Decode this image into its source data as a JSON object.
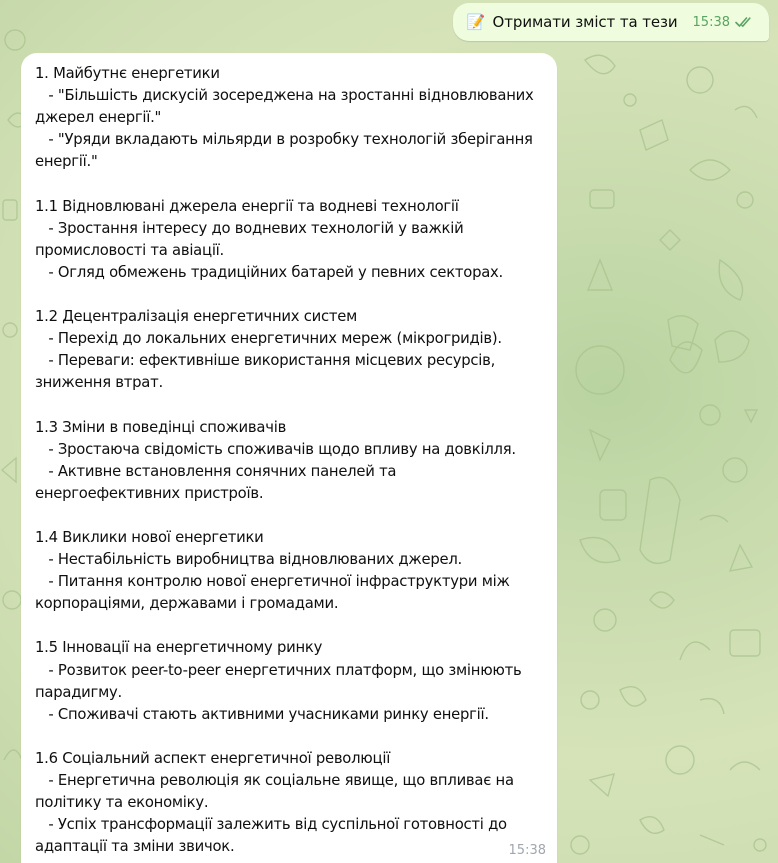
{
  "outgoing_message": {
    "emoji": "📝",
    "text": "Отримати зміст та тези",
    "time": "15:38",
    "status_icon": "double-check-icon"
  },
  "incoming_message": {
    "time": "15:38",
    "lines": [
      "1. Майбутнє енергетики",
      "   - \"Більшість дискусій зосереджена на зростанні відновлюваних",
      "джерел енергії.\"",
      "   - \"Уряди вкладають мільярди в розробку технологій зберігання",
      "енергії.\"",
      "",
      "1.1 Відновлювані джерела енергії та водневі технології",
      "   - Зростання інтересу до водневих технологій у важкій",
      "промисловості та авіації.",
      "   - Огляд обмежень традиційних батарей у певних секторах.",
      "",
      "1.2 Децентралізація енергетичних систем",
      "   - Перехід до локальних енергетичних мереж (мікрогридів).",
      "   - Переваги: ефективніше використання місцевих ресурсів,",
      "зниження втрат.",
      "",
      "1.3 Зміни в поведінці споживачів",
      "   - Зростаюча свідомість споживачів щодо впливу на довкілля.",
      "   - Активне встановлення сонячних панелей та",
      "енергоефективних пристроїв.",
      "",
      "1.4 Виклики нової енергетики",
      "   - Нестабільність виробництва відновлюваних джерел.",
      "   - Питання контролю нової енергетичної інфраструктури між",
      "корпораціями, державами і громадами.",
      "",
      "1.5 Інновації на енергетичному ринку",
      "   - Розвиток peer-to-peer енергетичних платформ, що змінюють",
      "парадигму.",
      "   - Споживачі стають активними учасниками ринку енергії.",
      "",
      "1.6 Соціальний аспект енергетичної революції",
      "   - Енергетична революція як соціальне явище, що впливає на",
      "політику та економіку.",
      "   - Успіх трансформації залежить від суспільної готовності до",
      "адаптації та зміни звичок."
    ]
  }
}
